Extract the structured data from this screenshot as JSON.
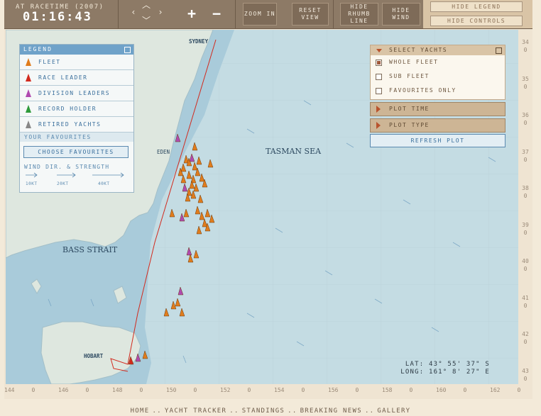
{
  "toolbar": {
    "racetime_label": "AT RACETIME (2007)",
    "racetime_value": "01:16:43",
    "zoom_in_label": "ZOOM IN",
    "reset_view_label": "RESET VIEW",
    "hide_rhumb_label": "HIDE RHUMB LINE",
    "hide_wind_label": "HIDE WIND",
    "hide_legend_label": "HIDE LEGEND",
    "hide_controls_label": "HIDE CONTROLS"
  },
  "map": {
    "labels": {
      "sydney": "SYDNEY",
      "eden": "EDEN",
      "hobart": "HOBART",
      "tasman_sea": "TASMAN SEA",
      "bass_strait": "BASS STRAIT"
    },
    "lat_ticks": [
      {
        "deg": "34",
        "min": "0"
      },
      {
        "deg": "35",
        "min": "0"
      },
      {
        "deg": "36",
        "min": "0"
      },
      {
        "deg": "37",
        "min": "0"
      },
      {
        "deg": "38",
        "min": "0"
      },
      {
        "deg": "39",
        "min": "0"
      },
      {
        "deg": "40",
        "min": "0"
      },
      {
        "deg": "41",
        "min": "0"
      },
      {
        "deg": "42",
        "min": "0"
      },
      {
        "deg": "43",
        "min": "0"
      }
    ],
    "lon_ticks": [
      {
        "deg": "144",
        "min": "0"
      },
      {
        "deg": "146",
        "min": "0"
      },
      {
        "deg": "148",
        "min": "0"
      },
      {
        "deg": "150",
        "min": "0"
      },
      {
        "deg": "152",
        "min": "0"
      },
      {
        "deg": "154",
        "min": "0"
      },
      {
        "deg": "156",
        "min": "0"
      },
      {
        "deg": "158",
        "min": "0"
      },
      {
        "deg": "160",
        "min": "0"
      },
      {
        "deg": "162",
        "min": "0"
      }
    ],
    "cursor_lat": "LAT: 43° 55' 37\" S",
    "cursor_long": "LONG: 161° 8' 27\" E",
    "colors": {
      "sea": "#c4dce3",
      "land": "#dfe7e0",
      "shelf": "#a3c6d6",
      "rhumb_line": "#d22a1e",
      "fleet_marker": "#e07c1c"
    }
  },
  "legend": {
    "title": "LEGEND",
    "items": [
      {
        "label": "FLEET",
        "icon": "fleet-marker-icon",
        "color": "#e07c1c"
      },
      {
        "label": "RACE LEADER",
        "icon": "race-leader-marker-icon",
        "color": "#d22a1e"
      },
      {
        "label": "DIVISION LEADERS",
        "icon": "division-leader-marker-icon",
        "color": "#b04ab0"
      },
      {
        "label": "RECORD HOLDER",
        "icon": "record-holder-marker-icon",
        "color": "#2d9a3a"
      },
      {
        "label": "RETIRED YACHTS",
        "icon": "retired-marker-icon",
        "color": "#888888"
      }
    ],
    "favourites_label": "YOUR FAVOURITES",
    "choose_favourites_label": "CHOOSE FAVOURITES",
    "wind_label": "WIND DIR. & STRENGTH",
    "wind_scale": [
      "10KT",
      "20KT",
      "40KT"
    ]
  },
  "select_yachts": {
    "title": "SELECT YACHTS",
    "options": [
      {
        "label": "WHOLE FLEET",
        "checked": true
      },
      {
        "label": "SUB FLEET",
        "checked": false
      },
      {
        "label": "FAVOURITES ONLY",
        "checked": false
      }
    ],
    "plot_time_label": "PLOT TIME",
    "plot_type_label": "PLOT TYPE",
    "refresh_label": "REFRESH PLOT"
  },
  "footer": {
    "links": [
      "HOME",
      "YACHT TRACKER",
      "STANDINGS",
      "BREAKING NEWS",
      "GALLERY"
    ],
    "separator": ".."
  }
}
